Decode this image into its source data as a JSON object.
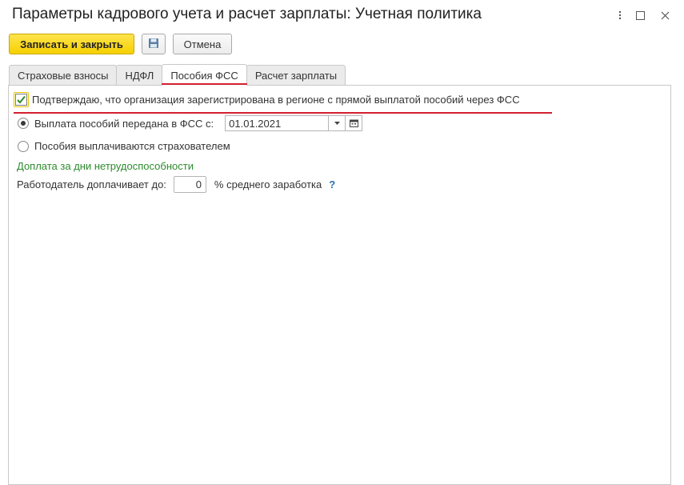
{
  "window": {
    "title": "Параметры кадрового учета и расчет зарплаты: Учетная политика",
    "icons": [
      "more-vertical-icon",
      "maximize-icon",
      "close-icon"
    ]
  },
  "toolbar": {
    "save_close_label": "Записать и закрыть",
    "save_icon": "floppy-disk-icon",
    "cancel_label": "Отмена"
  },
  "tabs": [
    {
      "label": "Страховые взносы",
      "active": false
    },
    {
      "label": "НДФЛ",
      "active": false
    },
    {
      "label": "Пособия ФСС",
      "active": true
    },
    {
      "label": "Расчет зарплаты",
      "active": false
    }
  ],
  "fss": {
    "confirm_checkbox_label": "Подтверждаю, что организация зарегистрирована в регионе с прямой выплатой пособий через ФСС",
    "confirm_checked": true,
    "radio_direct_label": "Выплата пособий передана в ФСС с:",
    "radio_direct_selected": true,
    "date_value": "01.01.2021",
    "radio_insurer_label": "Пособия выплачиваются страхователем",
    "radio_insurer_selected": false
  },
  "surcharge": {
    "section_title": "Доплата за дни нетрудоспособности",
    "employer_label": "Работодатель доплачивает до:",
    "percent_value": "0",
    "percent_suffix": "% среднего заработка",
    "help_label": "?"
  },
  "colors": {
    "primary_button": "#f5d000",
    "accent_red": "#d2202f",
    "section_green": "#2e8b2e",
    "help_blue": "#2a6fb0"
  }
}
